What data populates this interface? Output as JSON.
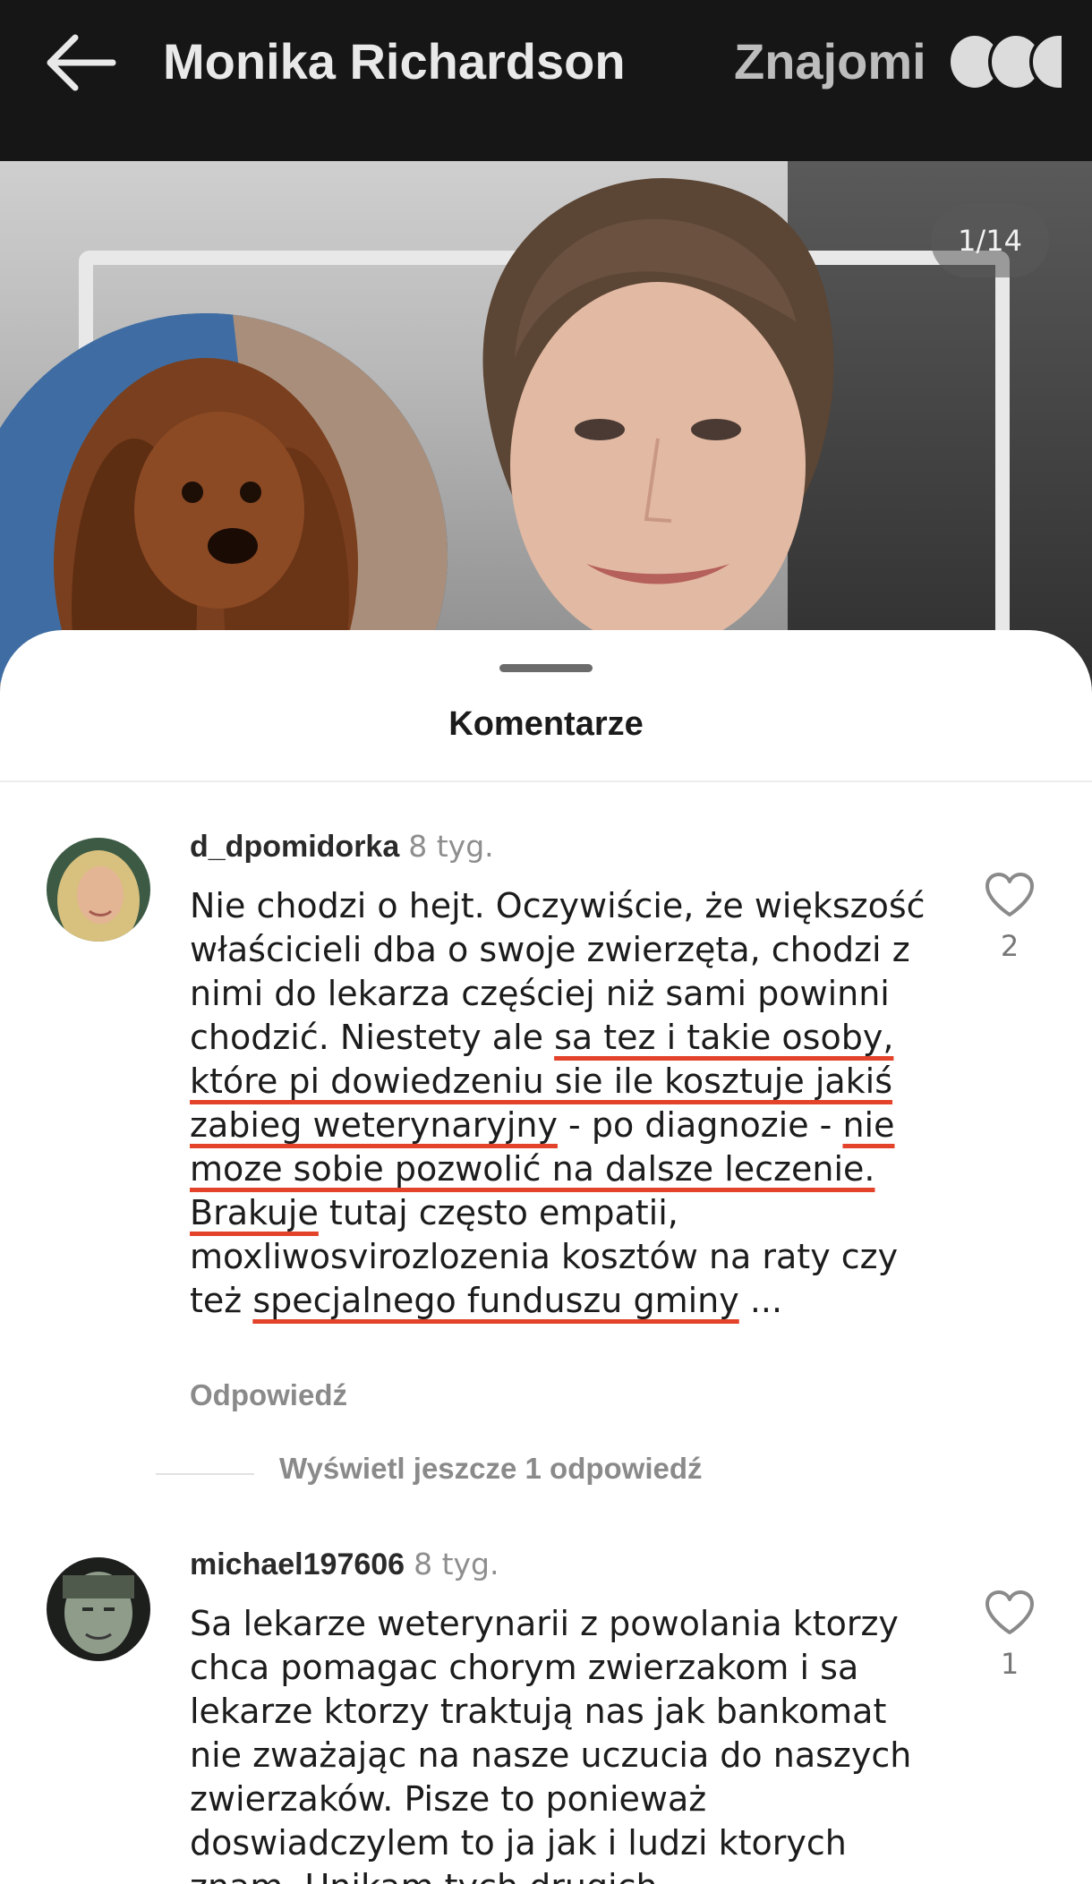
{
  "header": {
    "title": "Monika Richardson",
    "friends_label": "Znajomi"
  },
  "photo": {
    "counter": "1/14"
  },
  "sheet": {
    "title": "Komentarze",
    "more_replies": "Wyświetl jeszcze 1 odpowiedź"
  },
  "comments": [
    {
      "username": "d_dpomidorka",
      "time": "8 tyg.",
      "text_parts": [
        "Nie chodzi o hejt. Oczywiście,  że większość właścicieli dba o swoje zwierzęta, chodzi z nimi do lekarza częściej niż sami powinni chodzić. Niestety ale ",
        "sa tez i takie osoby, które pi dowiedzeniu sie ile kosztuje jakiś zabieg weterynaryjny",
        " - po diagnozie - ",
        "nie moze sobie pozwolić na dalsze leczenie.  Brakuje",
        " tutaj często empatii, moxliwosvirozlozenia kosztów na raty czy też ",
        "specjalnego funduszu gminy",
        " ..."
      ],
      "reply_label": "Odpowiedź",
      "likes": "2"
    },
    {
      "username": "michael197606",
      "time": "8 tyg.",
      "text": "Sa lekarze weterynarii z powolania ktorzy chca pomagac chorym zwierzakom i sa lekarze ktorzy traktują nas jak bankomat nie zważając na nasze uczucia do naszych zwierzaków. Pisze to ponieważ doswiadczylem to ja jak i ludzi ktorych znam. Unikam tych drugich",
      "likes": "1"
    }
  ]
}
